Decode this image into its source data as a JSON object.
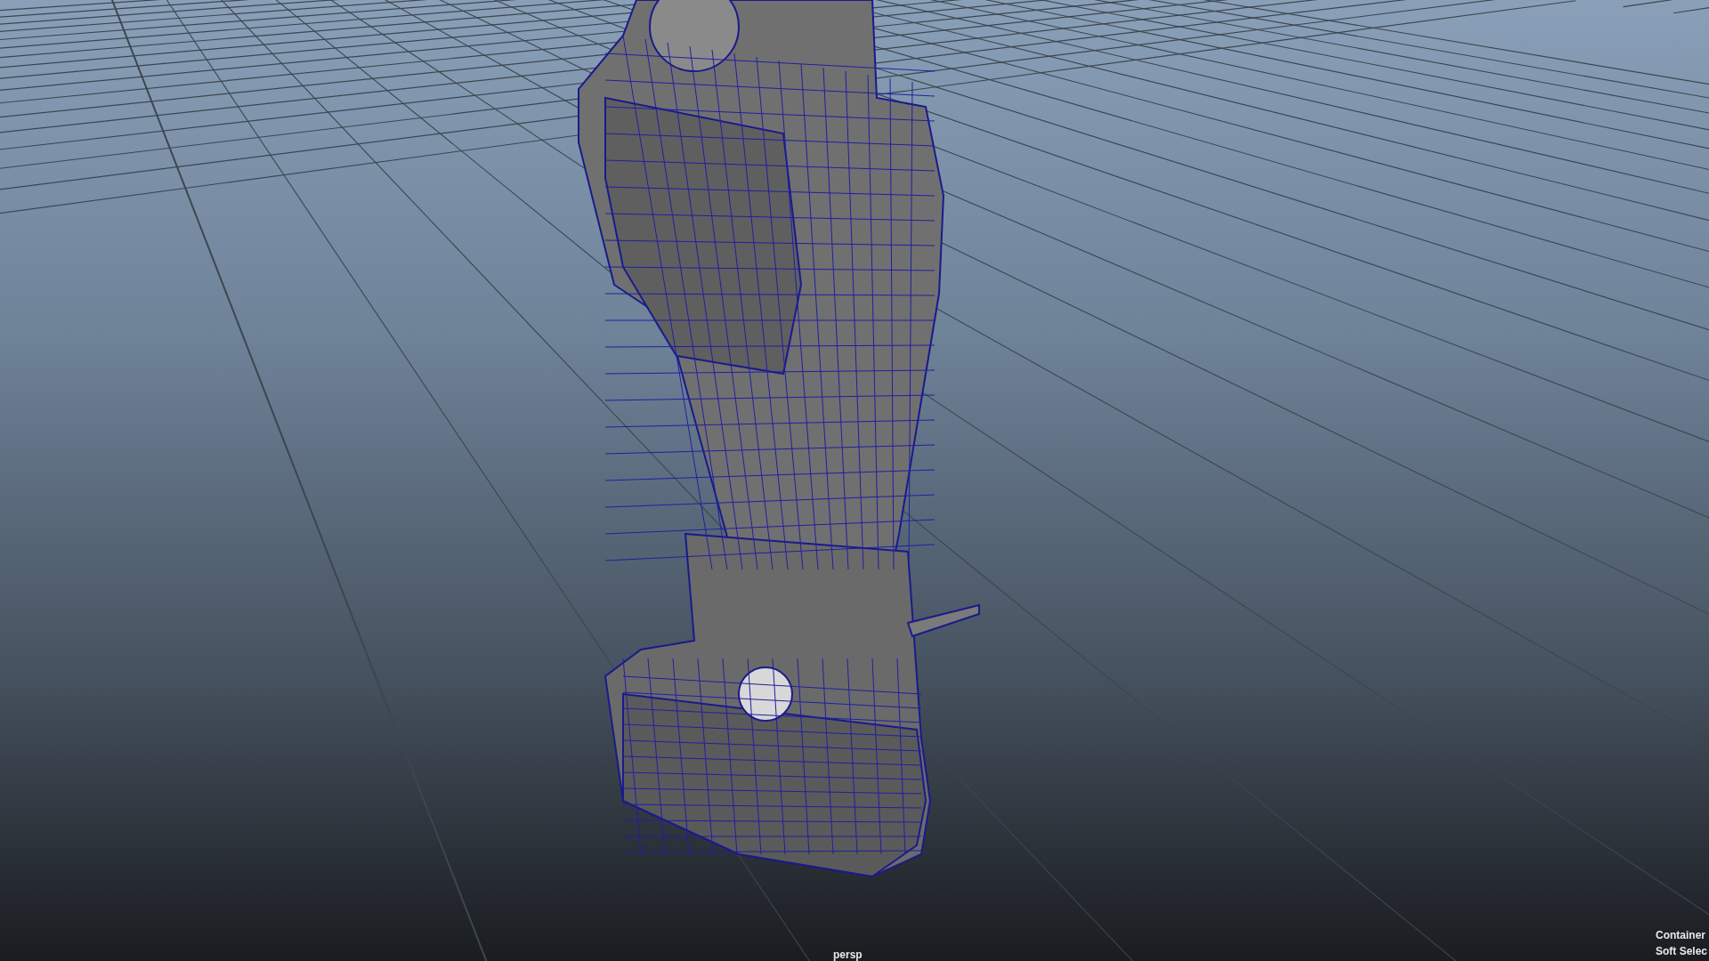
{
  "viewport": {
    "camera_label": "persp",
    "hud_labels": [
      "Container",
      "Soft Selec"
    ]
  }
}
